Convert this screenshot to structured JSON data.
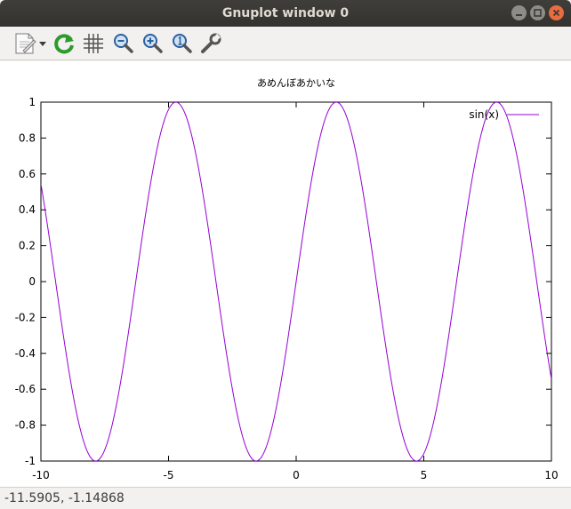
{
  "window": {
    "title": "Gnuplot window 0",
    "controls": [
      "minimize",
      "maximize",
      "close"
    ]
  },
  "toolbar": {
    "buttons": [
      {
        "name": "export-icon",
        "label": ""
      },
      {
        "name": "replot-icon",
        "label": ""
      },
      {
        "name": "grid-icon",
        "label": ""
      },
      {
        "name": "zoom-previous-icon",
        "label": ""
      },
      {
        "name": "zoom-next-icon",
        "label": ""
      },
      {
        "name": "autoscale-icon",
        "label": ""
      },
      {
        "name": "settings-icon",
        "label": ""
      }
    ]
  },
  "chart_data": {
    "type": "line",
    "title": "あめんぼあかいな",
    "xlabel": "",
    "ylabel": "",
    "xlim": [
      -10,
      10
    ],
    "ylim": [
      -1,
      1
    ],
    "x_ticks": [
      "-10",
      "-5",
      "0",
      "5",
      "10"
    ],
    "y_ticks": [
      "-1",
      "-0.8",
      "-0.6",
      "-0.4",
      "-0.2",
      "0",
      "0.2",
      "0.4",
      "0.6",
      "0.8",
      "1"
    ],
    "grid": false,
    "legend_position": "top-right",
    "series": [
      {
        "name": "sin(x)",
        "color": "#9400d3",
        "function": "sin(x)",
        "x": [
          -10,
          -9,
          -8,
          -7,
          -6,
          -5,
          -4,
          -3,
          -2,
          -1,
          0,
          1,
          2,
          3,
          4,
          5,
          6,
          7,
          8,
          9,
          10
        ],
        "values": [
          0.544,
          -0.412,
          -0.989,
          -0.657,
          0.279,
          0.959,
          0.757,
          -0.141,
          -0.909,
          -0.841,
          0,
          0.841,
          0.909,
          0.141,
          -0.757,
          -0.959,
          -0.279,
          0.657,
          0.989,
          0.412,
          -0.544
        ]
      }
    ]
  },
  "statusbar": {
    "coordinates": "-11.5905, -1.14868"
  }
}
